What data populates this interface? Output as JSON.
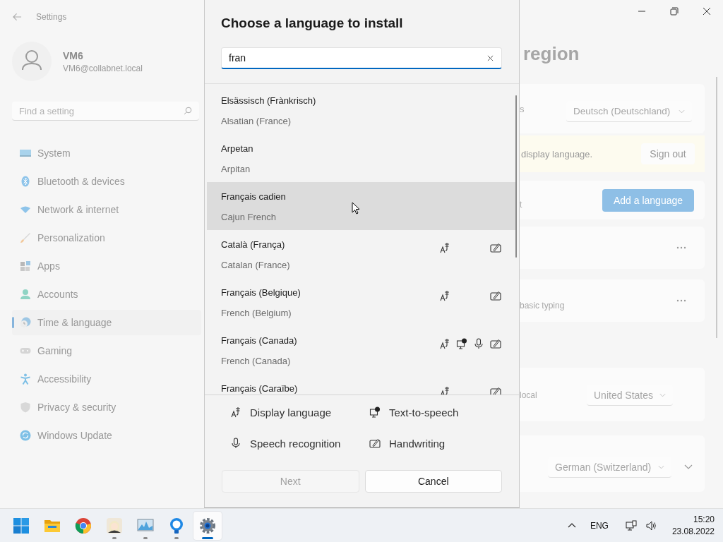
{
  "settings": {
    "title": "Settings",
    "user": {
      "name": "VM6",
      "email": "VM6@collabnet.local"
    },
    "search": {
      "placeholder": "Find a setting"
    },
    "nav": [
      {
        "kind": "system",
        "label": "System",
        "selected": false
      },
      {
        "kind": "bluetooth",
        "label": "Bluetooth & devices",
        "selected": false
      },
      {
        "kind": "network",
        "label": "Network & internet",
        "selected": false
      },
      {
        "kind": "brush",
        "label": "Personalization",
        "selected": false
      },
      {
        "kind": "apps",
        "label": "Apps",
        "selected": false
      },
      {
        "kind": "accounts",
        "label": "Accounts",
        "selected": false
      },
      {
        "kind": "time",
        "label": "Time & language",
        "selected": true
      },
      {
        "kind": "gaming",
        "label": "Gaming",
        "selected": false
      },
      {
        "kind": "accessibility",
        "label": "Accessibility",
        "selected": false
      },
      {
        "kind": "privacy",
        "label": "Privacy & security",
        "selected": false
      },
      {
        "kind": "update",
        "label": "Windows Update",
        "selected": false
      }
    ],
    "page_title": "region",
    "display_row": {
      "label": "s",
      "value": "Deutsch (Deutschland)"
    },
    "banner": {
      "text": "display language.",
      "button": "Sign out"
    },
    "languages_row": {
      "label": "t",
      "button": "Add a language"
    },
    "typing_row": {
      "caption": "basic typing"
    },
    "country_row": {
      "label": "local",
      "value": "United States"
    },
    "format_row": {
      "value": "German (Switzerland)"
    }
  },
  "dialog": {
    "title": "Choose a language to install",
    "search": {
      "value": "fran"
    },
    "languages": [
      {
        "name": "Elsässisch (Frànkrisch)",
        "english": "Alsatian (France)",
        "selected": false
      },
      {
        "name": "Arpetan",
        "english": "Arpitan",
        "selected": false
      },
      {
        "name": "Français cadien",
        "english": "Cajun French",
        "selected": true
      },
      {
        "name": "Català (França)",
        "english": "Catalan (France)",
        "selected": false,
        "display": true,
        "tts": false,
        "speech": false,
        "handwriting": true
      },
      {
        "name": "Français (Belgique)",
        "english": "French (Belgium)",
        "selected": false,
        "display": true,
        "tts": false,
        "speech": false,
        "handwriting": true
      },
      {
        "name": "Français (Canada)",
        "english": "French (Canada)",
        "selected": false,
        "display": true,
        "tts": true,
        "speech": true,
        "handwriting": true
      },
      {
        "name": "Français (Caraïbe)",
        "selected": false,
        "display": true,
        "tts": false,
        "speech": false,
        "handwriting": true
      }
    ],
    "legend": [
      {
        "kind": "display",
        "label": "Display language"
      },
      {
        "kind": "tts",
        "label": "Text-to-speech"
      },
      {
        "kind": "speech",
        "label": "Speech recognition"
      },
      {
        "kind": "handwriting",
        "label": "Handwriting"
      }
    ],
    "buttons": [
      {
        "label": "Next",
        "disabled": true
      },
      {
        "label": "Cancel",
        "disabled": false
      }
    ]
  },
  "taskbar": {
    "apps": [
      {
        "kind": "start",
        "running": false,
        "selected": false
      },
      {
        "kind": "explorer",
        "running": false,
        "selected": false
      },
      {
        "kind": "chrome",
        "running": false,
        "selected": false
      },
      {
        "kind": "figure",
        "running": true,
        "selected": false
      },
      {
        "kind": "monitor",
        "running": true,
        "selected": false
      },
      {
        "kind": "bulb",
        "running": true,
        "selected": false
      },
      {
        "kind": "gear",
        "running": true,
        "selected": true
      }
    ],
    "language": "ENG",
    "time": "15:20",
    "date": "23.08.2022"
  }
}
